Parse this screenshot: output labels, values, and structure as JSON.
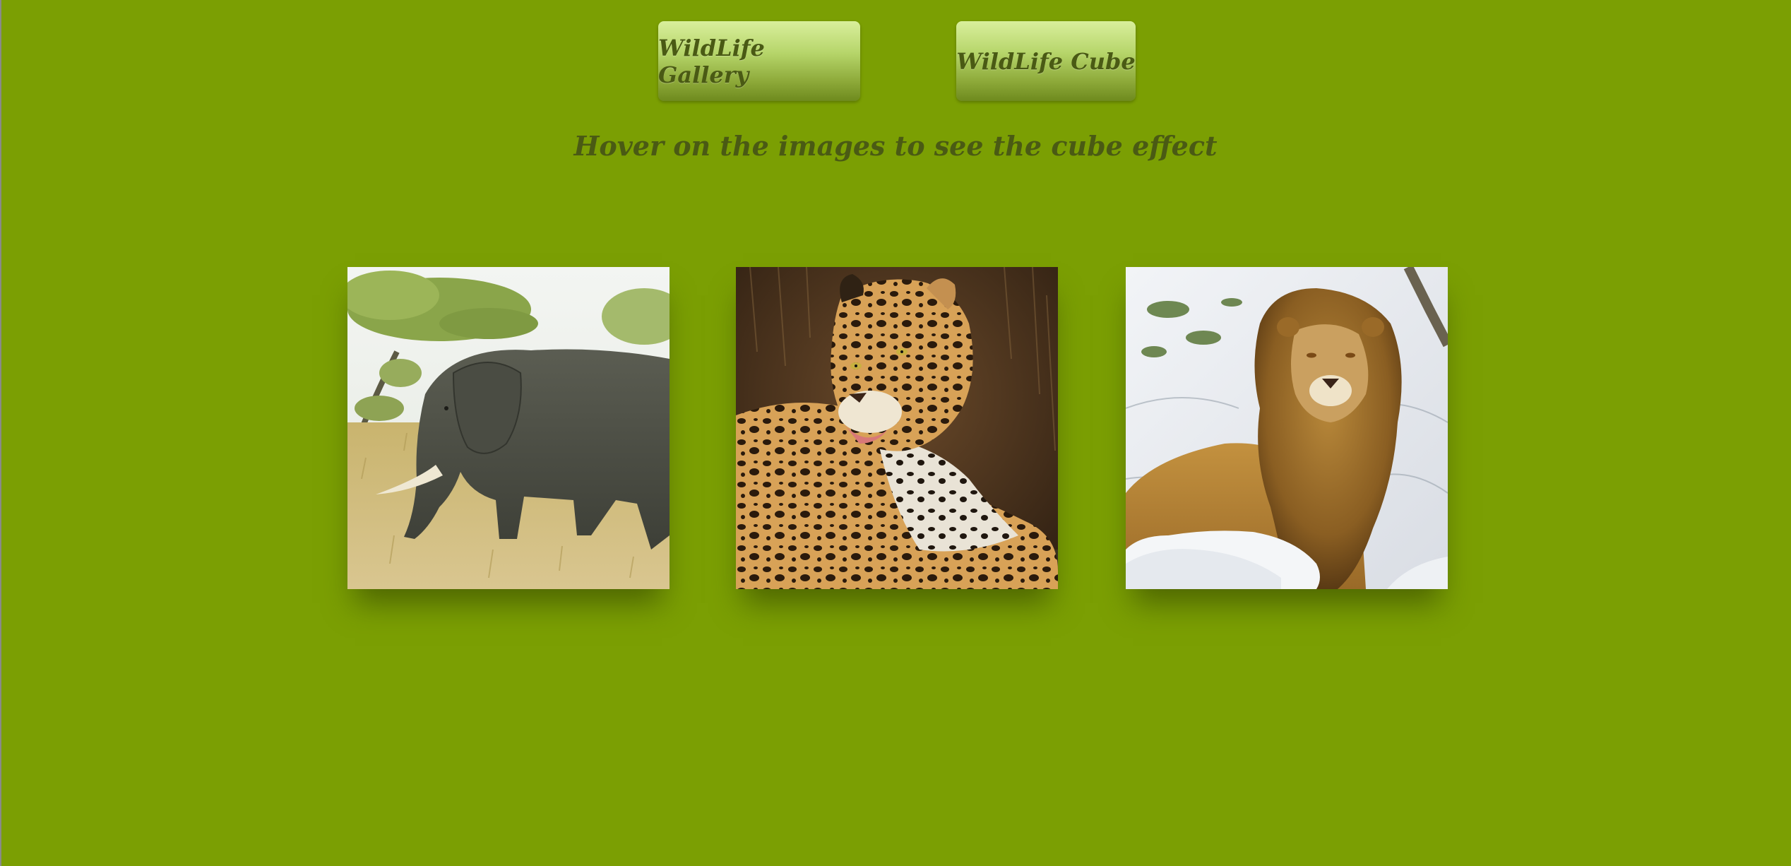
{
  "nav": {
    "gallery_label": "WildLife Gallery",
    "cube_label": "WildLife Cube"
  },
  "instruction": "Hover on the images to see the cube effect",
  "gallery": {
    "cards": [
      {
        "subject": "elephant"
      },
      {
        "subject": "leopard"
      },
      {
        "subject": "lion"
      }
    ]
  },
  "colors": {
    "background": "#7b9f03",
    "button_top": "#d9ef9c",
    "button_bottom": "#6e8a1e",
    "text": "#4a5a14"
  }
}
